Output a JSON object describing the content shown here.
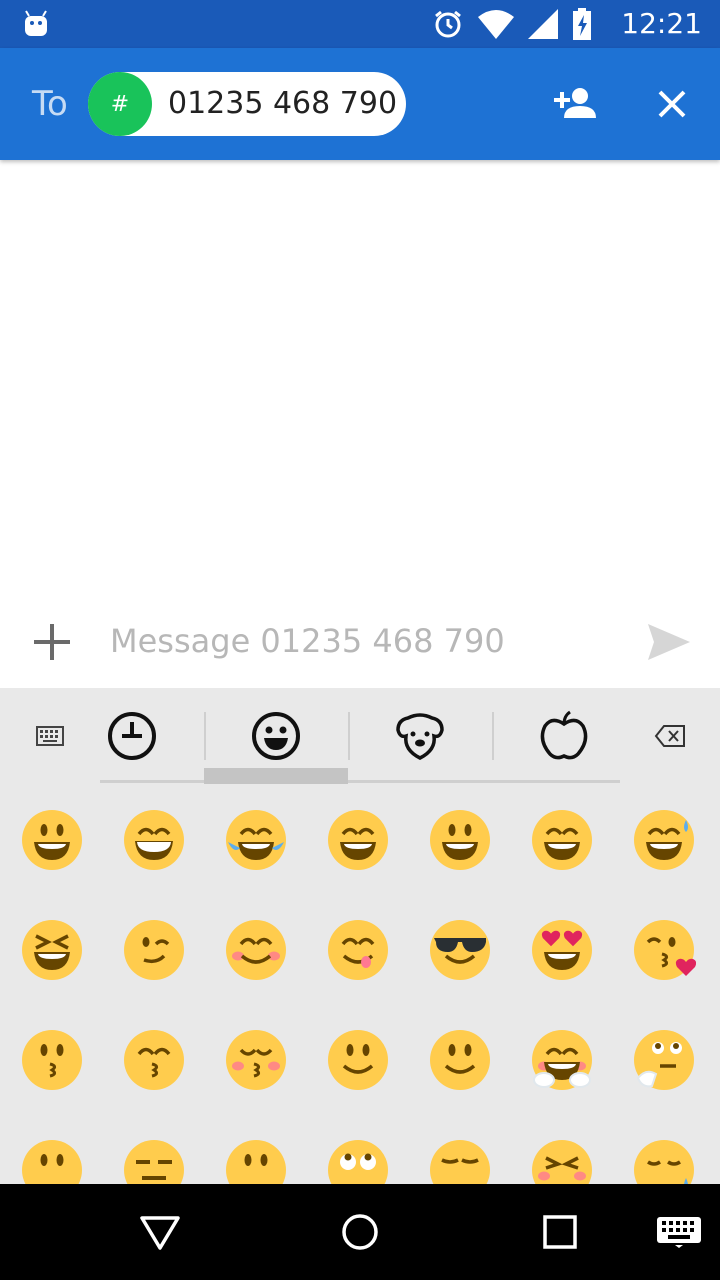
{
  "status_bar": {
    "time": "12:21",
    "icons": [
      "android-icon",
      "alarm-icon",
      "wifi-icon",
      "signal-icon",
      "battery-charging-icon"
    ]
  },
  "app_bar": {
    "to_label": "To",
    "recipient": {
      "avatar_text": "#",
      "avatar_color": "#19c35a",
      "number": "01235 468 790"
    },
    "actions": [
      "add-contact-icon",
      "close-icon"
    ],
    "colors": {
      "background": "#1e72d4",
      "status_background": "#1a5ab8"
    }
  },
  "compose": {
    "attach_icon": "plus-icon",
    "placeholder": "Message 01235 468 790",
    "value": "",
    "send_icon": "send-icon"
  },
  "emoji_keyboard": {
    "tabs": [
      "recent-icon",
      "smileys-icon",
      "animals-icon",
      "food-icon"
    ],
    "selected_tab": "smileys-icon",
    "rows": [
      [
        "grinning",
        "grin-teeth",
        "joy-tears",
        "rolling-laughing",
        "smiley",
        "smile",
        "sweat-smile"
      ],
      [
        "laughing",
        "wink",
        "blush",
        "yum",
        "sunglasses",
        "heart-eyes",
        "kissing-heart"
      ],
      [
        "kissing",
        "kissing-closed-eyes",
        "kissing-blush",
        "slight-smile",
        "slight-smile-2",
        "hugging",
        "thinking"
      ],
      [
        "no-mouth",
        "expressionless",
        "neutral",
        "rolling-eyes",
        "smirk",
        "persevere",
        "disappointed-relieved"
      ]
    ],
    "colors": {
      "face": "#ffcc4d",
      "feature": "#664500",
      "blush": "#ff7892",
      "tear": "#5dadec",
      "heart": "#e0245e"
    }
  },
  "nav_bar": {
    "buttons": [
      "back-icon",
      "home-icon",
      "recents-icon",
      "keyboard-switch-icon"
    ]
  }
}
